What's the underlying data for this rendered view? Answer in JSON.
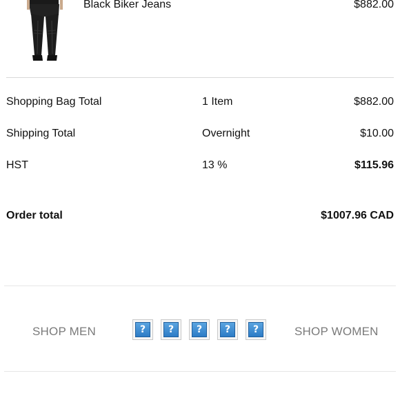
{
  "product": {
    "name": "Black Biker Jeans",
    "price": "$882.00",
    "image_icon": "jeans-image"
  },
  "summary": {
    "rows": [
      {
        "label": "Shopping Bag Total",
        "detail": "1 Item",
        "value": "$882.00"
      },
      {
        "label": "Shipping Total",
        "detail": "Overnight",
        "value": "$10.00"
      },
      {
        "label": "HST",
        "detail": "13 %",
        "value": "$115.96"
      }
    ],
    "order_total_label": "Order total",
    "order_total_value": "$1007.96 CAD"
  },
  "footer": {
    "shop_men": "SHOP MEN",
    "shop_women": "SHOP WOMEN",
    "social_icons": [
      {
        "name": "social-icon-1",
        "glyph": "?"
      },
      {
        "name": "social-icon-2",
        "glyph": "?"
      },
      {
        "name": "social-icon-3",
        "glyph": "?"
      },
      {
        "name": "social-icon-4",
        "glyph": "?"
      },
      {
        "name": "social-icon-5",
        "glyph": "?"
      }
    ]
  },
  "colors": {
    "divider": "#d9d9d9",
    "footer_link": "#7a7a7a",
    "placeholder_icon": "#2d7cc6"
  }
}
